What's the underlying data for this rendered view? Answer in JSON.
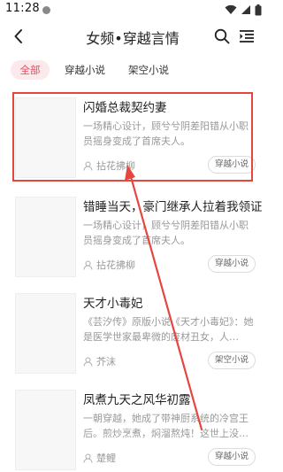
{
  "status_bar": {
    "time": "11:28"
  },
  "header": {
    "title": "女频•穿越言情",
    "icons": {
      "back": "back-arrow-icon",
      "search": "search-icon",
      "menu": "list-menu-icon"
    }
  },
  "tabs": [
    {
      "label": "全部",
      "active": true
    },
    {
      "label": "穿越小说",
      "active": false
    },
    {
      "label": "架空小说",
      "active": false
    }
  ],
  "books": [
    {
      "title": "闪婚总裁契约妻",
      "description": "一场精心设计，顾兮兮阴差阳错从小职员摇身变成了首席夫人。",
      "author": "拈花拂柳",
      "tag": "穿越小说"
    },
    {
      "title": "错睡当天，豪门继承人拉着我领证",
      "description": "一场精心设计，顾兮兮阴差阳错从小职员摇身变成了首席夫人。",
      "author": "拈花拂柳",
      "tag": "穿越小说"
    },
    {
      "title": "天才小毒妃",
      "description": "《芸汐传》原版小说《天才小毒妃》：她是医学世家最卑微的废材丑女，人…",
      "author": "芥沫",
      "tag": "架空小说"
    },
    {
      "title": "凤煮九天之风华初露",
      "description": "一朝穿越，她成了带神厨系统的冷宫王后。煎炒烹煮，焖溜熬炖！这世上没…",
      "author": "楚鲤",
      "tag": "穿越小说"
    }
  ],
  "colors": {
    "accent": "#e8475c",
    "annotation": "#e5473f"
  }
}
